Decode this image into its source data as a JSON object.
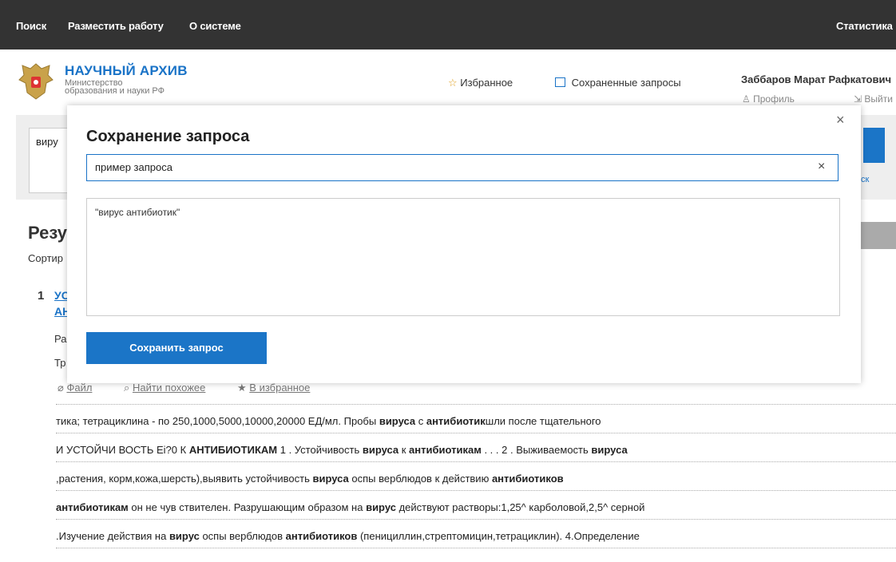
{
  "topnav": {
    "search": "Поиск",
    "submit_work": "Разместить работу",
    "about": "О системе",
    "stats": "Статистика"
  },
  "brand": {
    "title": "НАУЧНЫЙ АРХИВ",
    "sub1": "Министерство",
    "sub2": "образования и науки РФ"
  },
  "header_links": {
    "favorites": "Избранное",
    "saved_queries": "Сохраненные запросы"
  },
  "user": {
    "name": "Заббаров Марат Рафкатович",
    "profile": "Профиль",
    "logout": "Выйти"
  },
  "search": {
    "query_visible": "виру",
    "extended_fragment": "ск"
  },
  "results": {
    "title_fragment": "Резу",
    "sort_fragment": "Сортир",
    "item_number": "1",
    "item_title_line1": "УС",
    "item_title_line2": "АН",
    "meta1": "Ра",
    "meta2": "Тр",
    "actions": {
      "file": "Файл",
      "find_similar": "Найти похожее",
      "to_favorites": "В избранное"
    },
    "snippets": [
      [
        [
          "тика; тетрациклина - по 250,1000,5000,10000,20000 ЕД/мл. Пробы ",
          false
        ],
        [
          "вируса",
          true
        ],
        [
          " с ",
          false
        ],
        [
          "антибиотик",
          true
        ],
        [
          "шли после тщательного",
          false
        ]
      ],
      [
        [
          "И УСТОЙЧИ ВОСТЬ Ei?0 К ",
          false
        ],
        [
          "АНТИБИОТИКАМ",
          true
        ],
        [
          " 1 . Устойчивость ",
          false
        ],
        [
          "вируса",
          true
        ],
        [
          " к ",
          false
        ],
        [
          "антибиотикам",
          true
        ],
        [
          " . . . 2 . Выживаемость ",
          false
        ],
        [
          "вируса",
          true
        ]
      ],
      [
        [
          ",растения, корм,кожа,шерсть),выявить устойчивость ",
          false
        ],
        [
          "вируса",
          true
        ],
        [
          " оспы верблюдов к действию ",
          false
        ],
        [
          "антибиотиков",
          true
        ]
      ],
      [
        [
          "антибиотикам",
          true
        ],
        [
          " он не чув ствителен. Разрушающим образом на ",
          false
        ],
        [
          "вирус",
          true
        ],
        [
          " действуют растворы:1,25^ карболовой,2,5^ серной",
          false
        ]
      ],
      [
        [
          ".Изучение действия на ",
          false
        ],
        [
          "вирус",
          true
        ],
        [
          " оспы верблюдов ",
          false
        ],
        [
          "антибиотиков",
          true
        ],
        [
          " (пенициллин,стрептомицин,тетрациклин). 4.Определение",
          false
        ]
      ]
    ]
  },
  "modal": {
    "title": "Сохранение запроса",
    "name_value": "пример запроса",
    "query_text": "\"вирус антибиотик\"",
    "save_label": "Сохранить запрос",
    "close_glyph": "×",
    "clear_glyph": "×"
  },
  "colors": {
    "accent": "#1b75c7",
    "topbar": "#333333"
  }
}
